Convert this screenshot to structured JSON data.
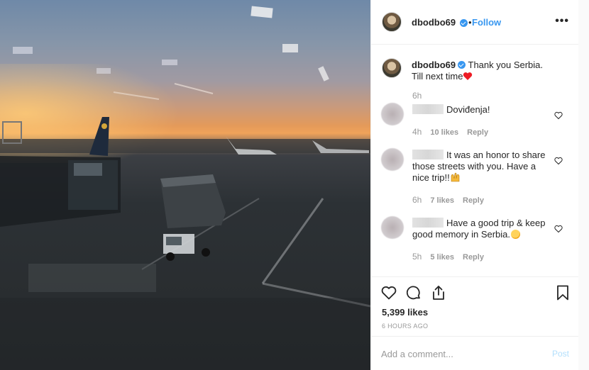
{
  "post": {
    "username": "dbodbo69",
    "follow_label": "Follow",
    "separator": "•",
    "more_label": "•••",
    "caption_text": "Thank you Serbia. Till next time",
    "caption_time": "6h"
  },
  "comments": [
    {
      "text": "Doviđenja!",
      "time": "4h",
      "likes": "10 likes",
      "reply": "Reply"
    },
    {
      "text": "It was an honor to share those streets with you. Have a nice trip!!",
      "time": "6h",
      "likes": "7 likes",
      "reply": "Reply"
    },
    {
      "text": "Have a good trip & keep good memory in Serbia.",
      "time": "5h",
      "likes": "5 likes",
      "reply": "Reply"
    }
  ],
  "actions": {
    "likes_count": "5,399 likes",
    "post_time": "6 HOURS AGO"
  },
  "composer": {
    "placeholder": "Add a comment...",
    "post_label": "Post"
  },
  "colors": {
    "accent": "#3897f0",
    "post_disabled": "#b2dffc",
    "heart_emoji": "#ed1c24"
  },
  "icons": [
    "heart-icon",
    "comment-icon",
    "share-icon",
    "bookmark-icon",
    "verified-badge-icon",
    "more-options-icon"
  ]
}
